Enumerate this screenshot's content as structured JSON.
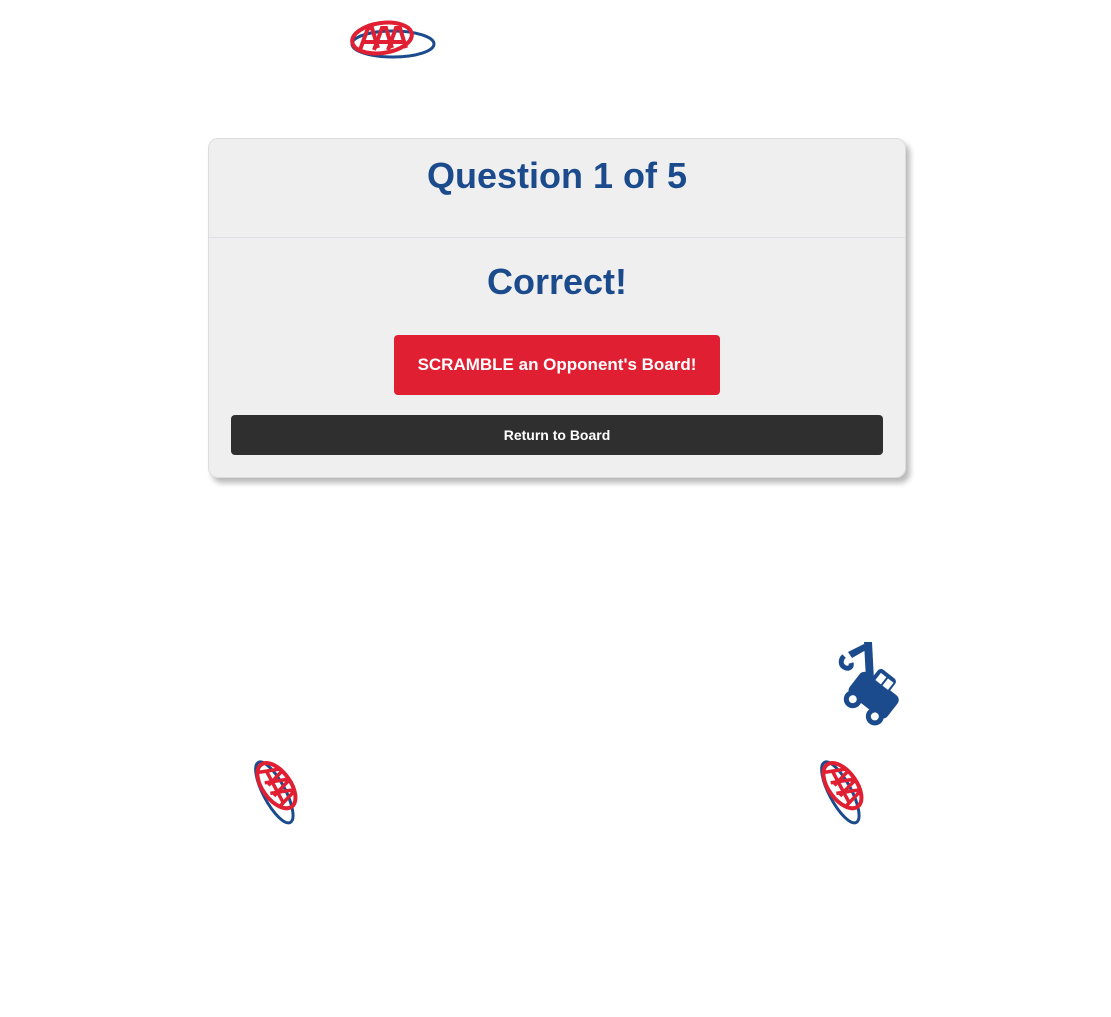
{
  "header": {
    "logo_icon": "aaa-logo-icon"
  },
  "modal": {
    "title": "Question 1 of 5",
    "result": "Correct!",
    "scramble_label": "SCRAMBLE an Opponent's Board!",
    "return_label": "Return to Board"
  },
  "decorations": {
    "tow_truck_icon": "tow-truck-icon",
    "logo_icons": [
      "aaa-logo-icon",
      "aaa-logo-icon"
    ]
  },
  "colors": {
    "brand_blue": "#1b4b8c",
    "brand_red": "#e01f32",
    "dark_button": "#2f2f2f",
    "panel_bg": "#efefef"
  }
}
